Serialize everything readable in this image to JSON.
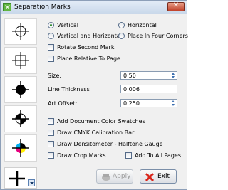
{
  "window": {
    "title": "Separation Marks",
    "close_icon": "close-icon"
  },
  "position": {
    "vertical": "Vertical",
    "horizontal": "Horizontal",
    "vertical_and_horizontal": "Vertical and Horizontal",
    "four_corners": "Place In Four Corners",
    "selected": "vertical"
  },
  "options": {
    "rotate_second_mark": "Rotate Second Mark",
    "place_relative_to_page": "Place Relative To Page"
  },
  "fields": {
    "size_label": "Size:",
    "size_value": "0.50",
    "line_thickness_label": "Line Thickness",
    "line_thickness_value": "0.006",
    "art_offset_label": "Art Offset:",
    "art_offset_value": "0.250"
  },
  "checks": {
    "add_doc_color_swatches": "Add Document Color Swatches",
    "draw_cmyk_bar": "Draw CMYK Calibration Bar",
    "draw_densitometer": "Draw Densitometer - Halftone Gauge",
    "draw_crop_marks": "Draw Crop Marks",
    "add_to_all_pages": "Add To All Pages."
  },
  "buttons": {
    "apply": "Apply",
    "exit": "Exit"
  },
  "colors": {
    "cyan": "#00aeef",
    "magenta": "#e6007e",
    "yellow": "#ffed00",
    "accent_red": "#d9261c"
  },
  "icons": [
    "crosshair-circle-icon",
    "crosshair-square-icon",
    "filled-circle-mark-icon",
    "quadrant-circle-mark-icon",
    "cmyk-circle-mark-icon",
    "cross-mark-icon",
    "apply-icon",
    "exit-x-icon"
  ]
}
